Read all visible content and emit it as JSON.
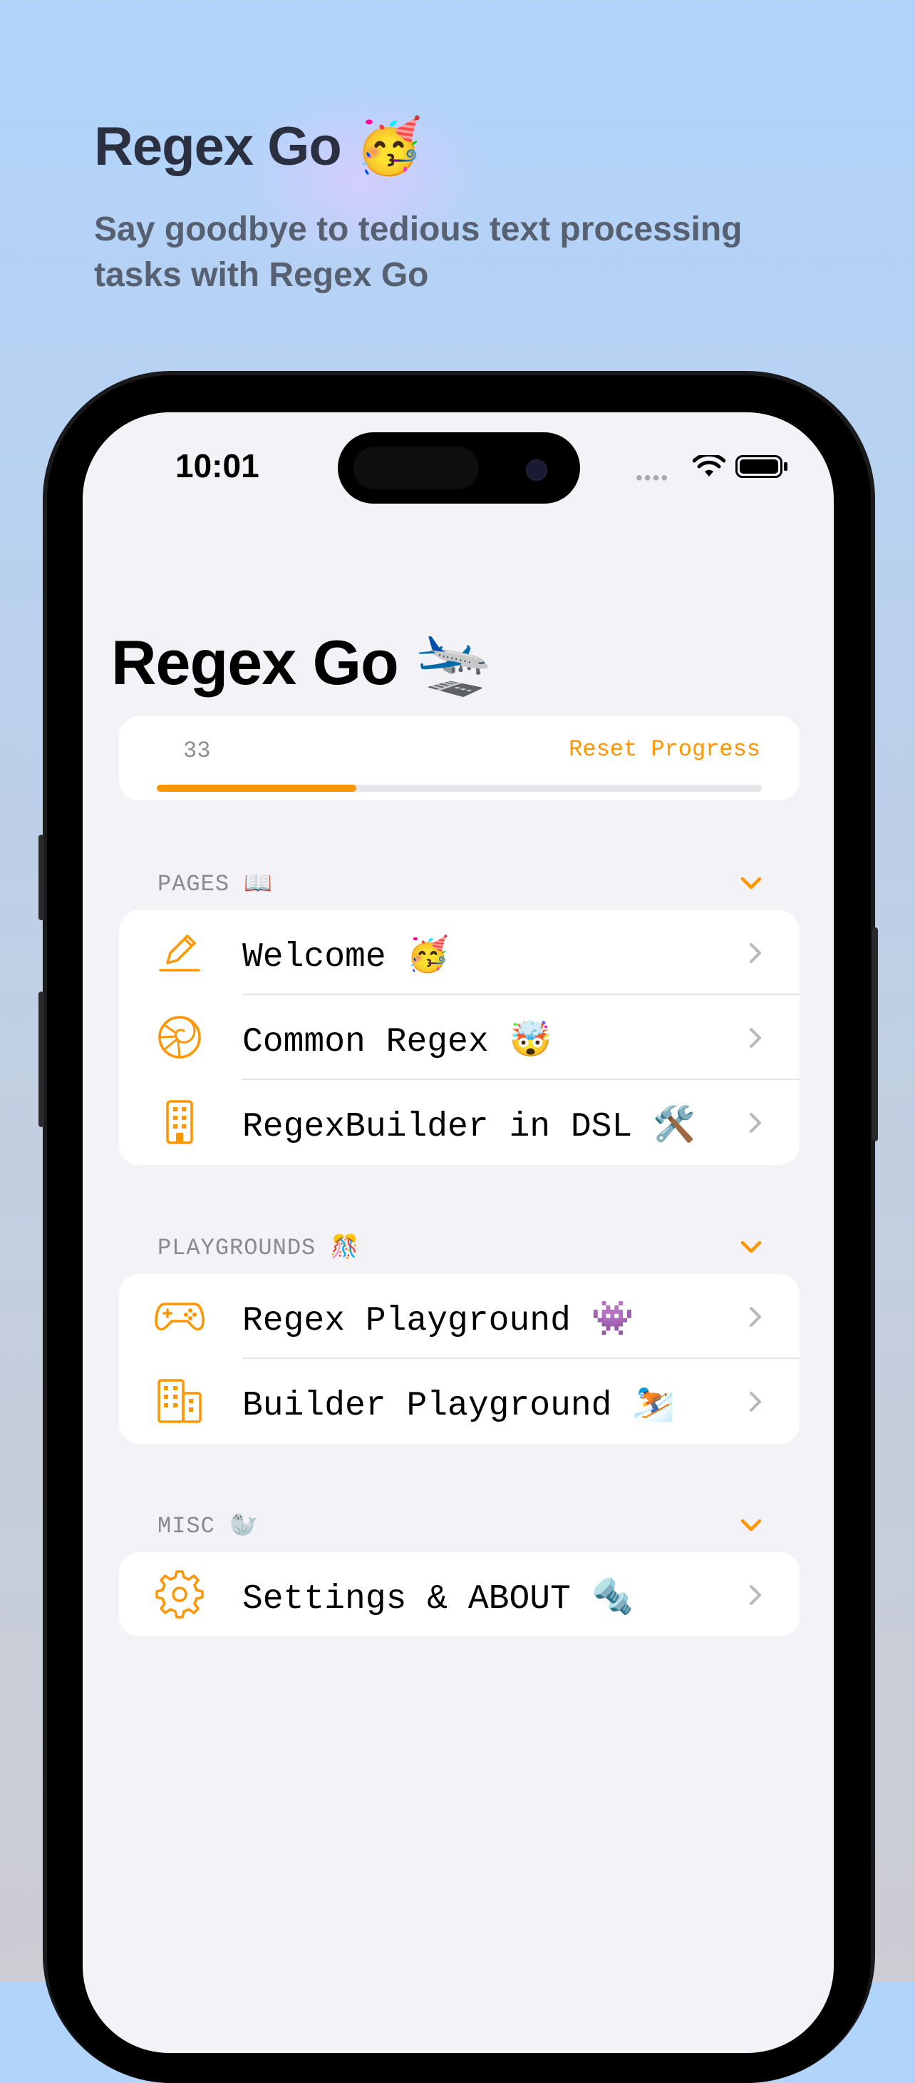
{
  "promo": {
    "title": "Regex Go 🥳",
    "subtitle": "Say goodbye to tedious text processing tasks with Regex Go"
  },
  "status_bar": {
    "time": "10:01"
  },
  "app": {
    "title": "Regex Go 🛬",
    "progress": {
      "count": "33",
      "fraction": 0.33,
      "reset_label": "Reset Progress"
    }
  },
  "sections": {
    "pages": {
      "header": "PAGES 📖",
      "items": [
        {
          "label": "Welcome 🥳",
          "icon": "pencil-icon"
        },
        {
          "label": "Common Regex 🤯",
          "icon": "shell-icon"
        },
        {
          "label": "RegexBuilder in DSL 🛠️",
          "icon": "building-icon"
        }
      ]
    },
    "playgrounds": {
      "header": "PLAYGROUNDS 🎊",
      "items": [
        {
          "label": "Regex Playground 👾",
          "icon": "gamecontroller-icon"
        },
        {
          "label": "Builder Playground ⛷️",
          "icon": "buildings-icon"
        }
      ]
    },
    "misc": {
      "header": "MISC 🦭",
      "items": [
        {
          "label": "Settings & ABOUT 🔩",
          "icon": "gear-icon"
        }
      ]
    }
  },
  "colors": {
    "accent": "#ff9500",
    "background": "#f2f2f7",
    "card": "#ffffff"
  }
}
